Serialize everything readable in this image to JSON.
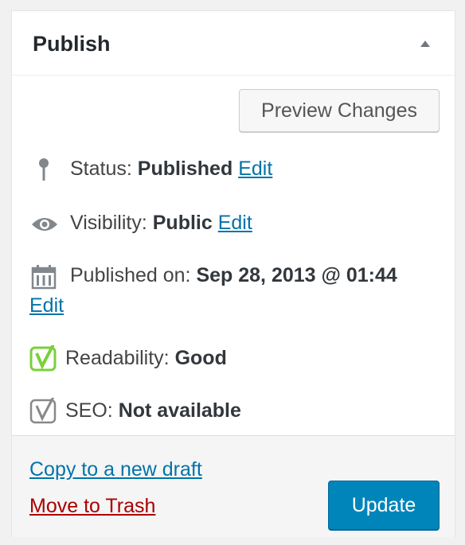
{
  "panel": {
    "title": "Publish",
    "toggle_icon": "triangle-up-icon"
  },
  "preview_button": "Preview Changes",
  "status": {
    "icon": "pin-icon",
    "label": "Status: ",
    "value": "Published",
    "edit": "Edit"
  },
  "visibility": {
    "icon": "eye-icon",
    "label": "Visibility: ",
    "value": "Public",
    "edit": "Edit"
  },
  "published_on": {
    "icon": "calendar-icon",
    "label": "Published on: ",
    "value": "Sep 28, 2013 @ 01:44",
    "edit": "Edit"
  },
  "readability": {
    "icon": "yoast-good-icon",
    "label": "Readability: ",
    "value": "Good",
    "icon_color": "#7ad03a"
  },
  "seo": {
    "icon": "yoast-na-icon",
    "label": "SEO: ",
    "value": "Not available",
    "icon_color": "#888888"
  },
  "footer": {
    "copy_link": "Copy to a new draft",
    "trash_link": "Move to Trash",
    "update_button": "Update"
  },
  "colors": {
    "link": "#0073aa",
    "trash": "#aa0000",
    "primary_button": "#0085ba"
  }
}
